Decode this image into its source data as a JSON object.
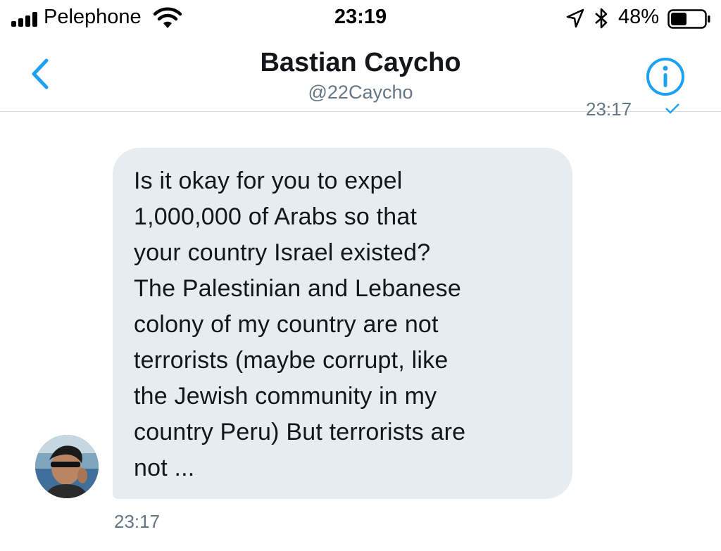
{
  "status_bar": {
    "carrier": "Pelephone",
    "time": "23:19",
    "battery_percent": "48%",
    "battery_level": 0.48,
    "icons": [
      "signal-icon",
      "wifi-icon",
      "location-arrow-icon",
      "bluetooth-icon",
      "battery-icon"
    ]
  },
  "header": {
    "name": "Bastian Caycho",
    "handle": "@22Caycho",
    "back_icon": "chevron-left-icon",
    "info_icon": "info-icon",
    "accent_color": "#1da1f2"
  },
  "conversation": {
    "previous_timestamp": "23:17",
    "message": {
      "text": "Is it okay for you to expel\n1,000,000 of Arabs so that\nyour country Israel existed?\nThe Palestinian and Lebanese\ncolony of my country are not\nterrorists (maybe corrupt, like\nthe Jewish community in my\ncountry Peru) But terrorists are\nnot ...",
      "timestamp": "23:17",
      "bubble_color": "#e6ecf0"
    }
  }
}
